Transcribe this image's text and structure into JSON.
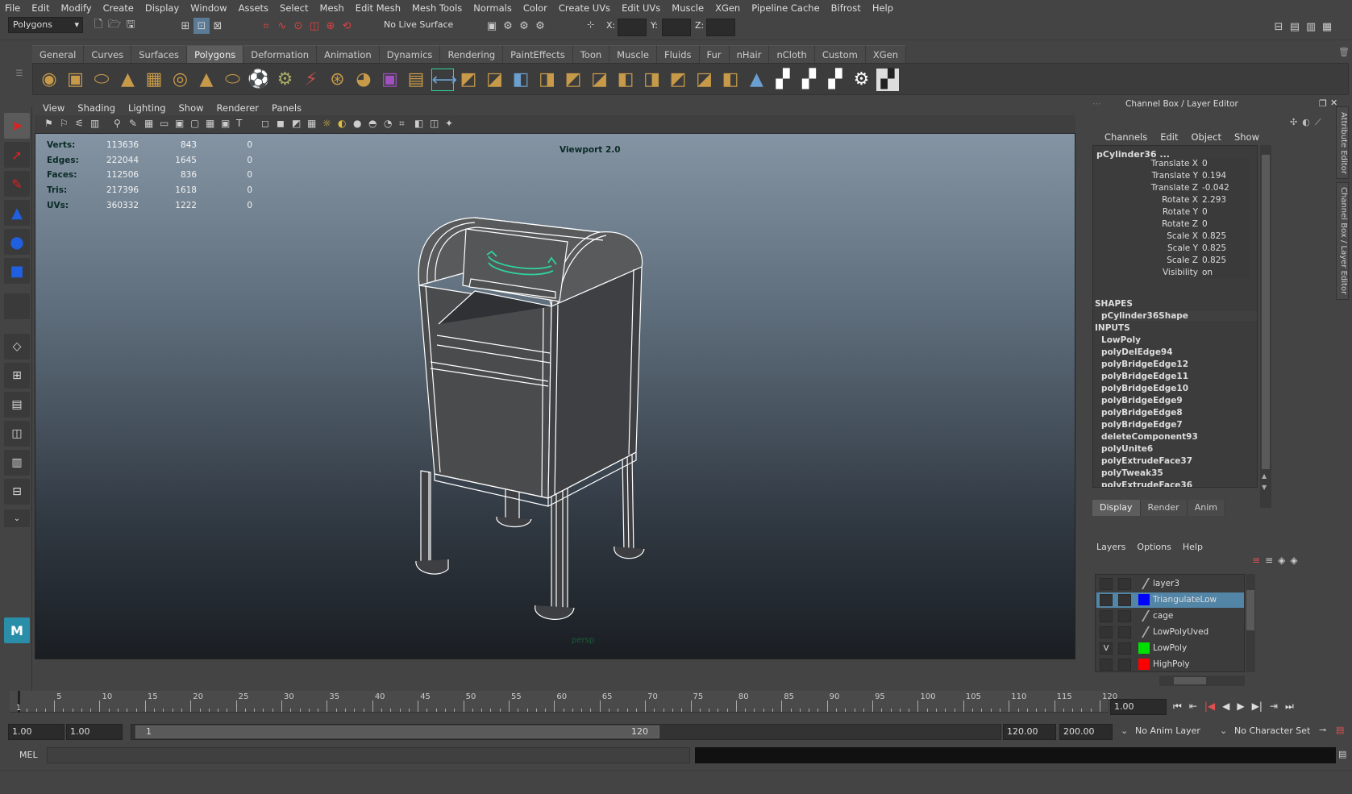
{
  "menubar": [
    "File",
    "Edit",
    "Modify",
    "Create",
    "Display",
    "Window",
    "Assets",
    "Select",
    "Mesh",
    "Edit Mesh",
    "Mesh Tools",
    "Normals",
    "Color",
    "Create UVs",
    "Edit UVs",
    "Muscle",
    "XGen",
    "Pipeline Cache",
    "Bifrost",
    "Help"
  ],
  "statusline": {
    "menuset": "Polygons",
    "live_surface": "No Live Surface",
    "x_label": "X:",
    "y_label": "Y:",
    "z_label": "Z:"
  },
  "shelf_tabs": [
    "General",
    "Curves",
    "Surfaces",
    "Polygons",
    "Deformation",
    "Animation",
    "Dynamics",
    "Rendering",
    "PaintEffects",
    "Toon",
    "Muscle",
    "Fluids",
    "Fur",
    "nHair",
    "nCloth",
    "Custom",
    "XGen"
  ],
  "shelf_active": "Polygons",
  "panel_menu": [
    "View",
    "Shading",
    "Lighting",
    "Show",
    "Renderer",
    "Panels"
  ],
  "hud": {
    "rows": [
      {
        "label": "Verts:",
        "a": "113636",
        "b": "843",
        "c": "0"
      },
      {
        "label": "Edges:",
        "a": "222044",
        "b": "1645",
        "c": "0"
      },
      {
        "label": "Faces:",
        "a": "112506",
        "b": "836",
        "c": "0"
      },
      {
        "label": "Tris:",
        "a": "217396",
        "b": "1618",
        "c": "0"
      },
      {
        "label": "UVs:",
        "a": "360332",
        "b": "1222",
        "c": "0"
      }
    ],
    "renderer": "Viewport 2.0",
    "camera": "persp"
  },
  "channel_box": {
    "title": "Channel Box / Layer Editor",
    "menu": [
      "Channels",
      "Edit",
      "Object",
      "Show"
    ],
    "object": "pCylinder36 ...",
    "attributes": [
      {
        "name": "Translate X",
        "value": "0"
      },
      {
        "name": "Translate Y",
        "value": "0.194"
      },
      {
        "name": "Translate Z",
        "value": "-0.042"
      },
      {
        "name": "Rotate X",
        "value": "2.293"
      },
      {
        "name": "Rotate Y",
        "value": "0"
      },
      {
        "name": "Rotate Z",
        "value": "0"
      },
      {
        "name": "Scale X",
        "value": "0.825"
      },
      {
        "name": "Scale Y",
        "value": "0.825"
      },
      {
        "name": "Scale Z",
        "value": "0.825"
      },
      {
        "name": "Visibility",
        "value": "on"
      }
    ],
    "shapes_header": "SHAPES",
    "shape": "pCylinder36Shape",
    "inputs_header": "INPUTS",
    "inputs": [
      "LowPoly",
      "polyDelEdge94",
      "polyBridgeEdge12",
      "polyBridgeEdge11",
      "polyBridgeEdge10",
      "polyBridgeEdge9",
      "polyBridgeEdge8",
      "polyBridgeEdge7",
      "deleteComponent93",
      "polyUnite6",
      "polyExtrudeFace37",
      "polyTweak35",
      "polyExtrudeFace36"
    ]
  },
  "side_tabs": [
    "Attribute Editor",
    "Channel Box / Layer Editor"
  ],
  "layer_editor": {
    "tabs": [
      "Display",
      "Render",
      "Anim"
    ],
    "active_tab": "Display",
    "menu": [
      "Layers",
      "Options",
      "Help"
    ],
    "layers": [
      {
        "name": "layer3",
        "v": "",
        "color": "",
        "selected": false
      },
      {
        "name": "TriangulateLow",
        "v": "",
        "color": "#0000ff",
        "selected": true
      },
      {
        "name": "cage",
        "v": "",
        "color": "",
        "selected": false
      },
      {
        "name": "LowPolyUved",
        "v": "",
        "color": "",
        "selected": false
      },
      {
        "name": "LowPoly",
        "v": "V",
        "color": "#00e000",
        "selected": false
      },
      {
        "name": "HighPoly",
        "v": "",
        "color": "#ff0000",
        "selected": false
      }
    ]
  },
  "timeline": {
    "ticks": [
      "5",
      "10",
      "15",
      "20",
      "25",
      "30",
      "35",
      "40",
      "45",
      "50",
      "55",
      "60",
      "65",
      "70",
      "75",
      "80",
      "85",
      "90",
      "95",
      "100",
      "105",
      "110",
      "115",
      "120"
    ],
    "current_marker": "1",
    "current_frame": "1.00"
  },
  "range": {
    "start": "1.00",
    "playback_start": "1.00",
    "slider_start": "1",
    "slider_end": "120",
    "playback_end": "120.00",
    "end": "200.00",
    "anim_layer": "No Anim Layer",
    "character_set": "No Character Set"
  },
  "command_line": {
    "label": "MEL"
  },
  "colors": {
    "selected_row": "#5285a6",
    "wire": "#ffffff",
    "selection_wire": "#2fd39a",
    "layer_blue": "#0000ff",
    "layer_green": "#00e000",
    "layer_red": "#ff0000"
  }
}
